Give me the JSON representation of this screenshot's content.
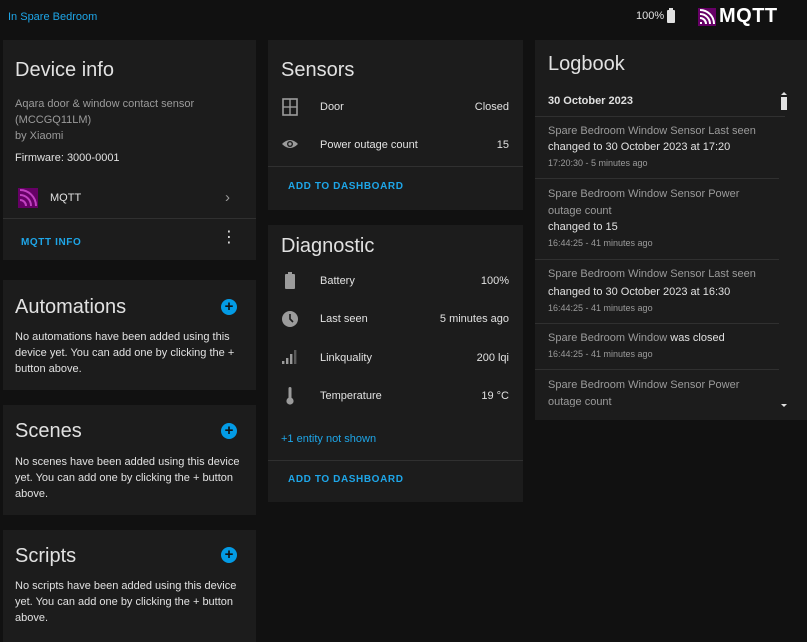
{
  "topbar": {
    "area_link": "In Spare Bedroom",
    "battery": "100%",
    "brand": "MQTT"
  },
  "device_info": {
    "title": "Device info",
    "model_line1": "Aqara door & window contact sensor",
    "model_line2": "(MCCGQ11LM)",
    "manufacturer": "by Xiaomi",
    "firmware": "Firmware: 3000-0001",
    "integration_label": "MQTT",
    "action_button": "MQTT INFO"
  },
  "automations": {
    "title": "Automations",
    "text": "No automations have been added using this device yet. You can add one by clicking the + button above."
  },
  "scenes": {
    "title": "Scenes",
    "text": "No scenes have been added using this device yet. You can add one by clicking the + button above."
  },
  "scripts": {
    "title": "Scripts",
    "text": "No scripts have been added using this device yet. You can add one by clicking the + button above."
  },
  "sensors": {
    "title": "Sensors",
    "rows": [
      {
        "label": "Door",
        "value": "Closed",
        "icon": "window-icon"
      },
      {
        "label": "Power outage count",
        "value": "15",
        "icon": "eye-icon"
      }
    ],
    "add_button": "ADD TO DASHBOARD"
  },
  "diagnostic": {
    "title": "Diagnostic",
    "rows": [
      {
        "label": "Battery",
        "value": "100%",
        "icon": "battery-icon"
      },
      {
        "label": "Last seen",
        "value": "5 minutes ago",
        "icon": "clock-icon"
      },
      {
        "label": "Linkquality",
        "value": "200 lqi",
        "icon": "signal-icon"
      },
      {
        "label": "Temperature",
        "value": "19 °C",
        "icon": "thermometer-icon"
      }
    ],
    "hidden_entities": "+1 entity not shown",
    "add_button": "ADD TO DASHBOARD"
  },
  "logbook": {
    "title": "Logbook",
    "date": "30 October 2023",
    "entries": [
      {
        "name": "Spare Bedroom Window Sensor Last seen",
        "action": "changed to 30 October 2023 at 17:20",
        "time": "17:20:30 - 5 minutes ago"
      },
      {
        "name_line1": "Spare Bedroom Window Sensor Power",
        "name_line2": "outage count",
        "action": "changed to 15",
        "time": "16:44:25 - 41 minutes ago"
      },
      {
        "name": "Spare Bedroom Window Sensor Last seen",
        "action": "changed to 30 October 2023 at 16:30",
        "time": "16:44:25 - 41 minutes ago"
      },
      {
        "name": "Spare Bedroom Window",
        "action": "was closed",
        "time": "16:44:25 - 41 minutes ago"
      },
      {
        "name_line1": "Spare Bedroom Window Sensor Power",
        "name_line2": "outage count"
      }
    ]
  },
  "colors": {
    "accent": "#039be5",
    "link": "#1ea6e8",
    "mqtt_purple": "#660066",
    "background": "#111111",
    "card": "#1c1c1c"
  }
}
